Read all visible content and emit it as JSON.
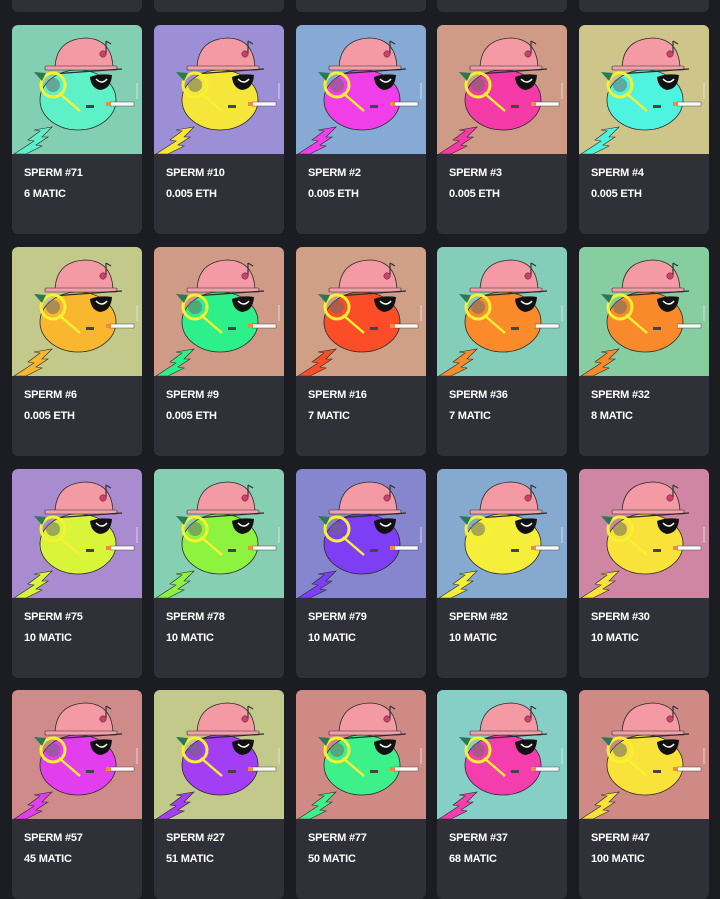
{
  "partial_row_count": 5,
  "cards": [
    {
      "name": "SPERM #71",
      "price": "6 MATIC",
      "bg": "#83cfb3",
      "body": "#5ef0c7"
    },
    {
      "name": "SPERM #10",
      "price": "0.005 ETH",
      "bg": "#9d8fd6",
      "body": "#f6e63a"
    },
    {
      "name": "SPERM #2",
      "price": "0.005 ETH",
      "bg": "#86aad4",
      "body": "#f03ee8"
    },
    {
      "name": "SPERM #3",
      "price": "0.005 ETH",
      "bg": "#cf9a86",
      "body": "#f33aa7"
    },
    {
      "name": "SPERM #4",
      "price": "0.005 ETH",
      "bg": "#cec58a",
      "body": "#4ff4e0"
    },
    {
      "name": "SPERM #6",
      "price": "0.005 ETH",
      "bg": "#c2c98b",
      "body": "#f9b730"
    },
    {
      "name": "SPERM #9",
      "price": "0.005 ETH",
      "bg": "#cf9a86",
      "body": "#2ef08a"
    },
    {
      "name": "SPERM #16",
      "price": "7 MATIC",
      "bg": "#cfa086",
      "body": "#fb4d27"
    },
    {
      "name": "SPERM #36",
      "price": "7 MATIC",
      "bg": "#84cdb8",
      "body": "#fb8a2a"
    },
    {
      "name": "SPERM #32",
      "price": "8 MATIC",
      "bg": "#86cda0",
      "body": "#f88a2c"
    },
    {
      "name": "SPERM #75",
      "price": "10 MATIC",
      "bg": "#a98bcf",
      "body": "#d8f53a"
    },
    {
      "name": "SPERM #78",
      "price": "10 MATIC",
      "bg": "#86cfb2",
      "body": "#8ef33e"
    },
    {
      "name": "SPERM #79",
      "price": "10 MATIC",
      "bg": "#8686cf",
      "body": "#7e3ef3"
    },
    {
      "name": "SPERM #82",
      "price": "10 MATIC",
      "bg": "#86aacf",
      "body": "#f5ee3a"
    },
    {
      "name": "SPERM #30",
      "price": "10 MATIC",
      "bg": "#cf86a3",
      "body": "#f9e23a"
    },
    {
      "name": "SPERM #57",
      "price": "45 MATIC",
      "bg": "#cf8a8a",
      "body": "#e23ef0"
    },
    {
      "name": "SPERM #27",
      "price": "51 MATIC",
      "bg": "#c2c98b",
      "body": "#a23ef3"
    },
    {
      "name": "SPERM #77",
      "price": "50 MATIC",
      "bg": "#cf8a86",
      "body": "#3ef08a"
    },
    {
      "name": "SPERM #37",
      "price": "68 MATIC",
      "bg": "#86cfc7",
      "body": "#f53eae"
    },
    {
      "name": "SPERM #47",
      "price": "100 MATIC",
      "bg": "#cf8a86",
      "body": "#f9e23a"
    }
  ]
}
